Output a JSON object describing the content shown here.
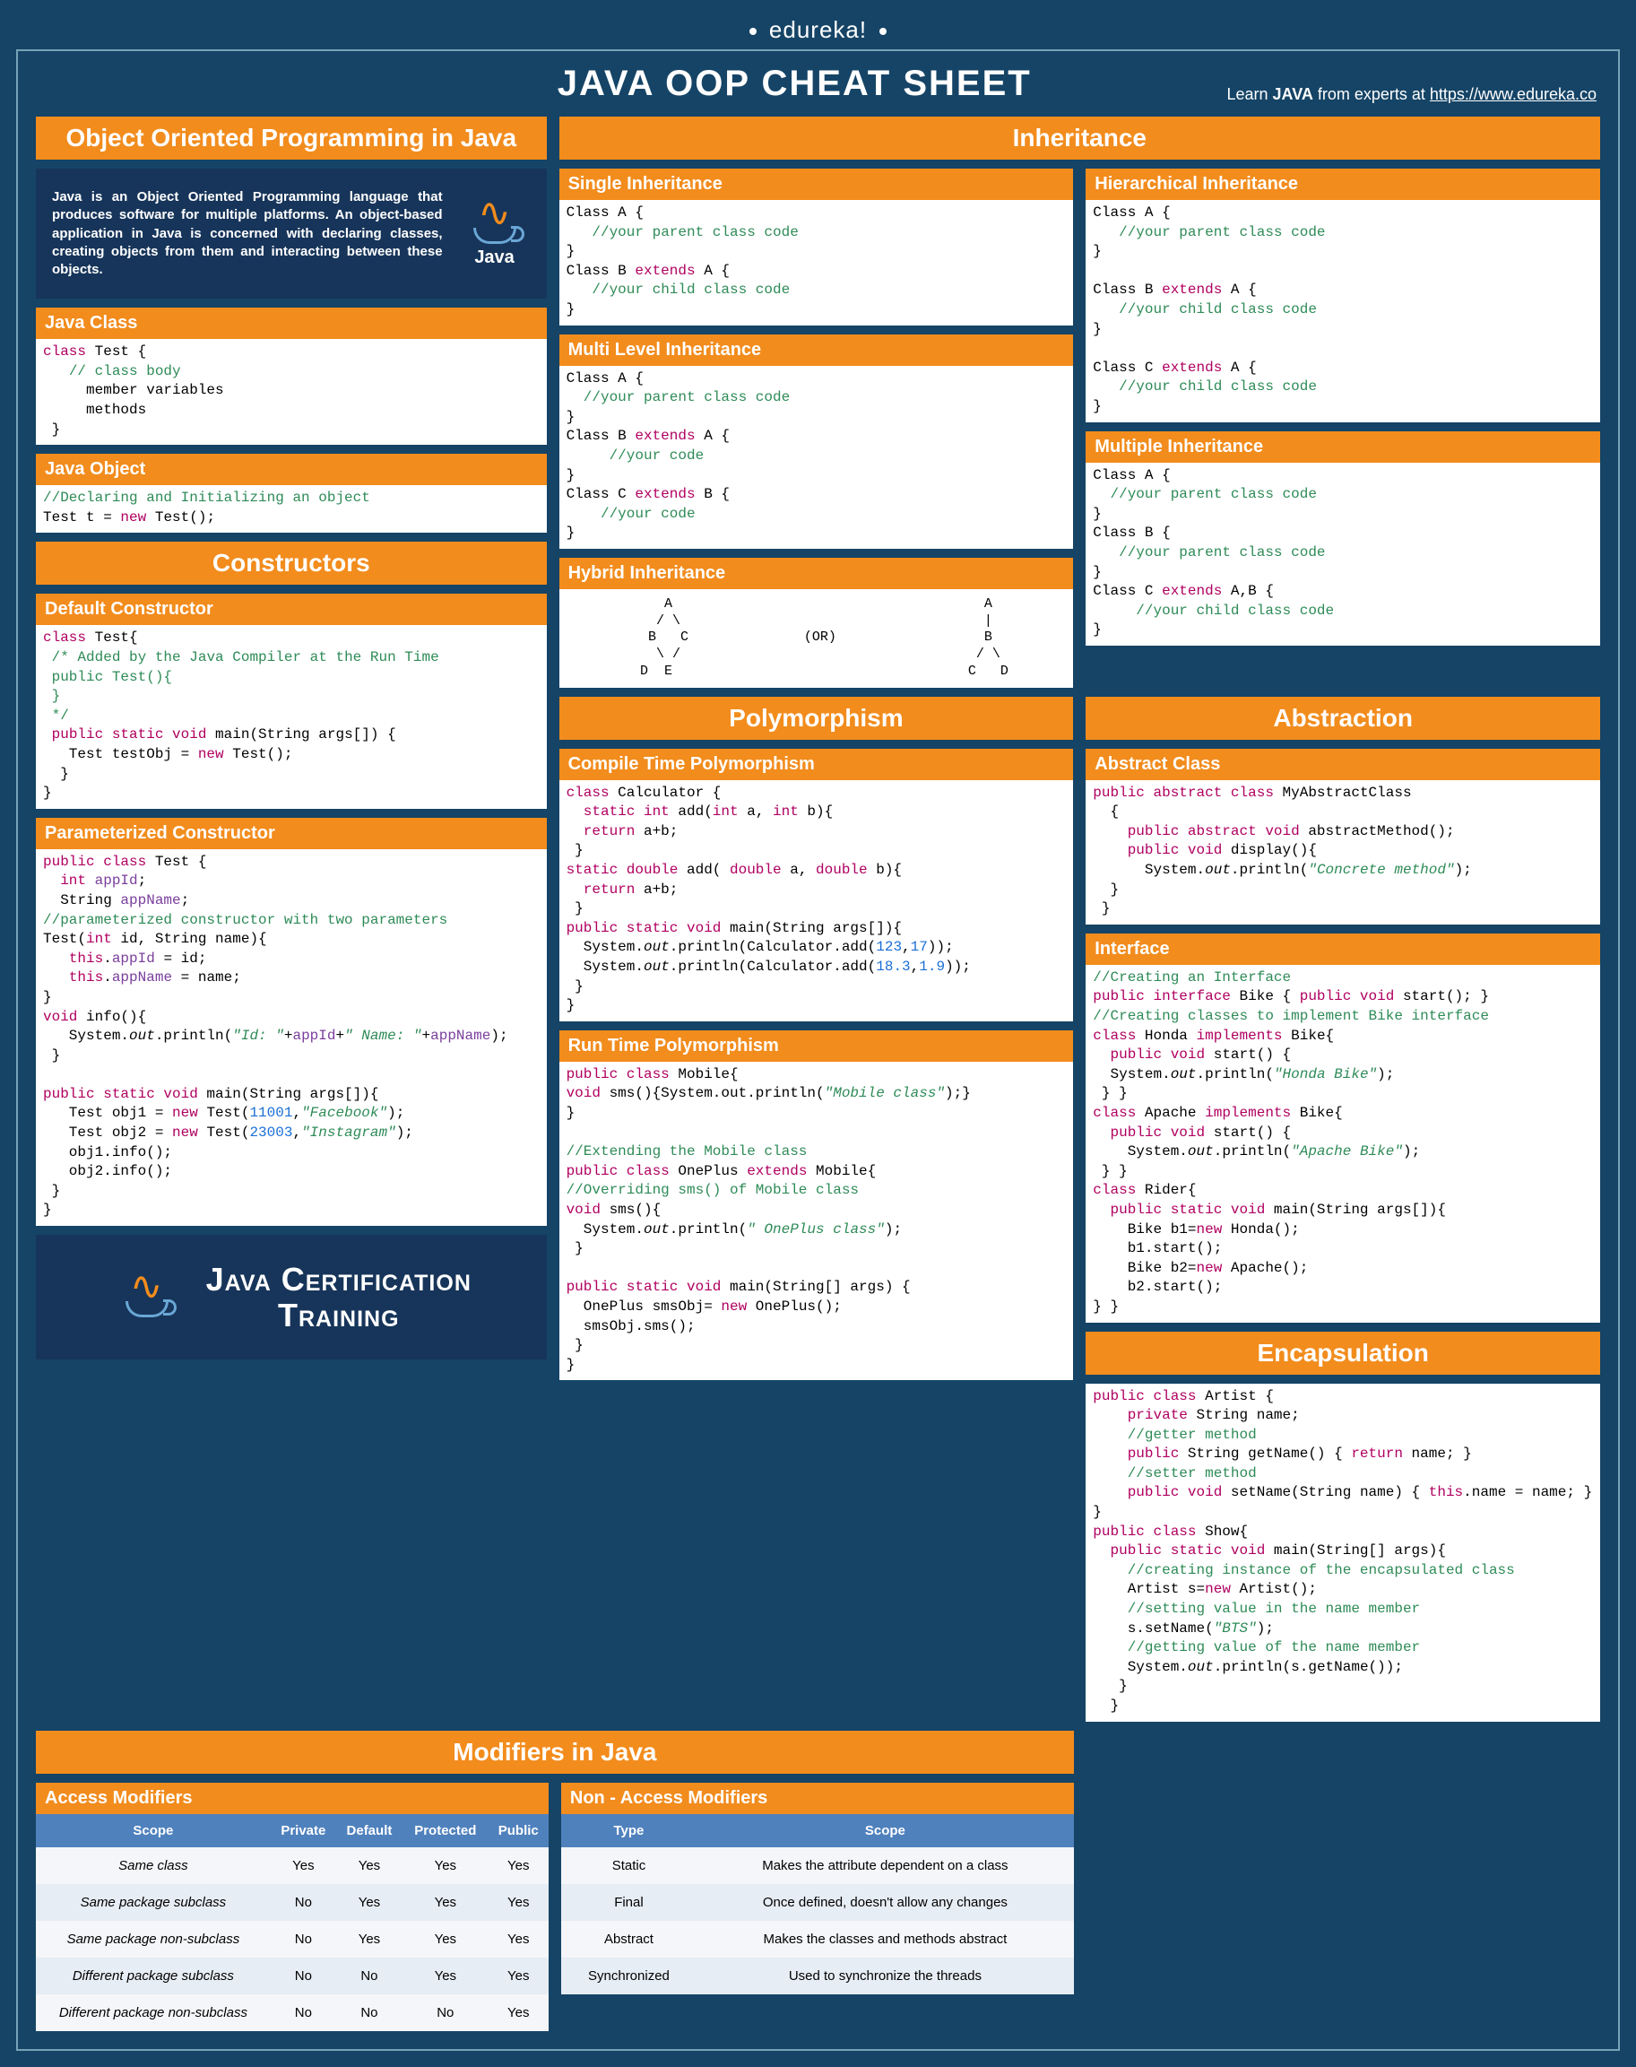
{
  "brand": "edureka!",
  "title": "JAVA OOP CHEAT SHEET",
  "learn_prefix": "Learn ",
  "learn_bold": "JAVA",
  "learn_suffix": " from experts at ",
  "learn_url": "https://www.edureka.co",
  "headers": {
    "oop_java": "Object Oriented Programming in Java",
    "constructors": "Constructors",
    "inheritance": "Inheritance",
    "polymorphism": "Polymorphism",
    "abstraction": "Abstraction",
    "encapsulation": "Encapsulation",
    "modifiers": "Modifiers in Java"
  },
  "intro_text": "Java is an Object Oriented Programming language that produces software for multiple platforms. An object-based application in Java is concerned with declaring classes, creating objects from them and interacting between these objects.",
  "sub": {
    "java_class": "Java Class",
    "java_object": "Java Object",
    "default_ctor": "Default Constructor",
    "param_ctor": "Parameterized Constructor",
    "single_inh": "Single Inheritance",
    "multi_level": "Multi Level Inheritance",
    "hybrid_inh": "Hybrid Inheritance",
    "hier_inh": "Hierarchical Inheritance",
    "multiple_inh": "Multiple Inheritance",
    "compile_poly": "Compile Time Polymorphism",
    "runtime_poly": "Run Time Polymorphism",
    "abstract_class": "Abstract Class",
    "interface": "Interface",
    "access_mod": "Access Modifiers",
    "non_access_mod": "Non - Access Modifiers"
  },
  "cert": "Java Certification Training",
  "access_table": {
    "head": [
      "Scope",
      "Private",
      "Default",
      "Protected",
      "Public"
    ],
    "rows": [
      [
        "Same class",
        "Yes",
        "Yes",
        "Yes",
        "Yes"
      ],
      [
        "Same package subclass",
        "No",
        "Yes",
        "Yes",
        "Yes"
      ],
      [
        "Same package non-subclass",
        "No",
        "Yes",
        "Yes",
        "Yes"
      ],
      [
        "Different package subclass",
        "No",
        "No",
        "Yes",
        "Yes"
      ],
      [
        "Different package non-subclass",
        "No",
        "No",
        "No",
        "Yes"
      ]
    ]
  },
  "non_access_table": {
    "head": [
      "Type",
      "Scope"
    ],
    "rows": [
      [
        "Static",
        "Makes the attribute dependent on a class"
      ],
      [
        "Final",
        "Once defined, doesn't allow any changes"
      ],
      [
        "Abstract",
        "Makes the classes and methods abstract"
      ],
      [
        "Synchronized",
        "Used to synchronize the threads"
      ]
    ]
  },
  "hybrid_or": "(OR)",
  "colors": {
    "bg": "#154466",
    "accent": "#f28c1d",
    "panel": "#17355a",
    "table_head": "#4f81bd"
  }
}
